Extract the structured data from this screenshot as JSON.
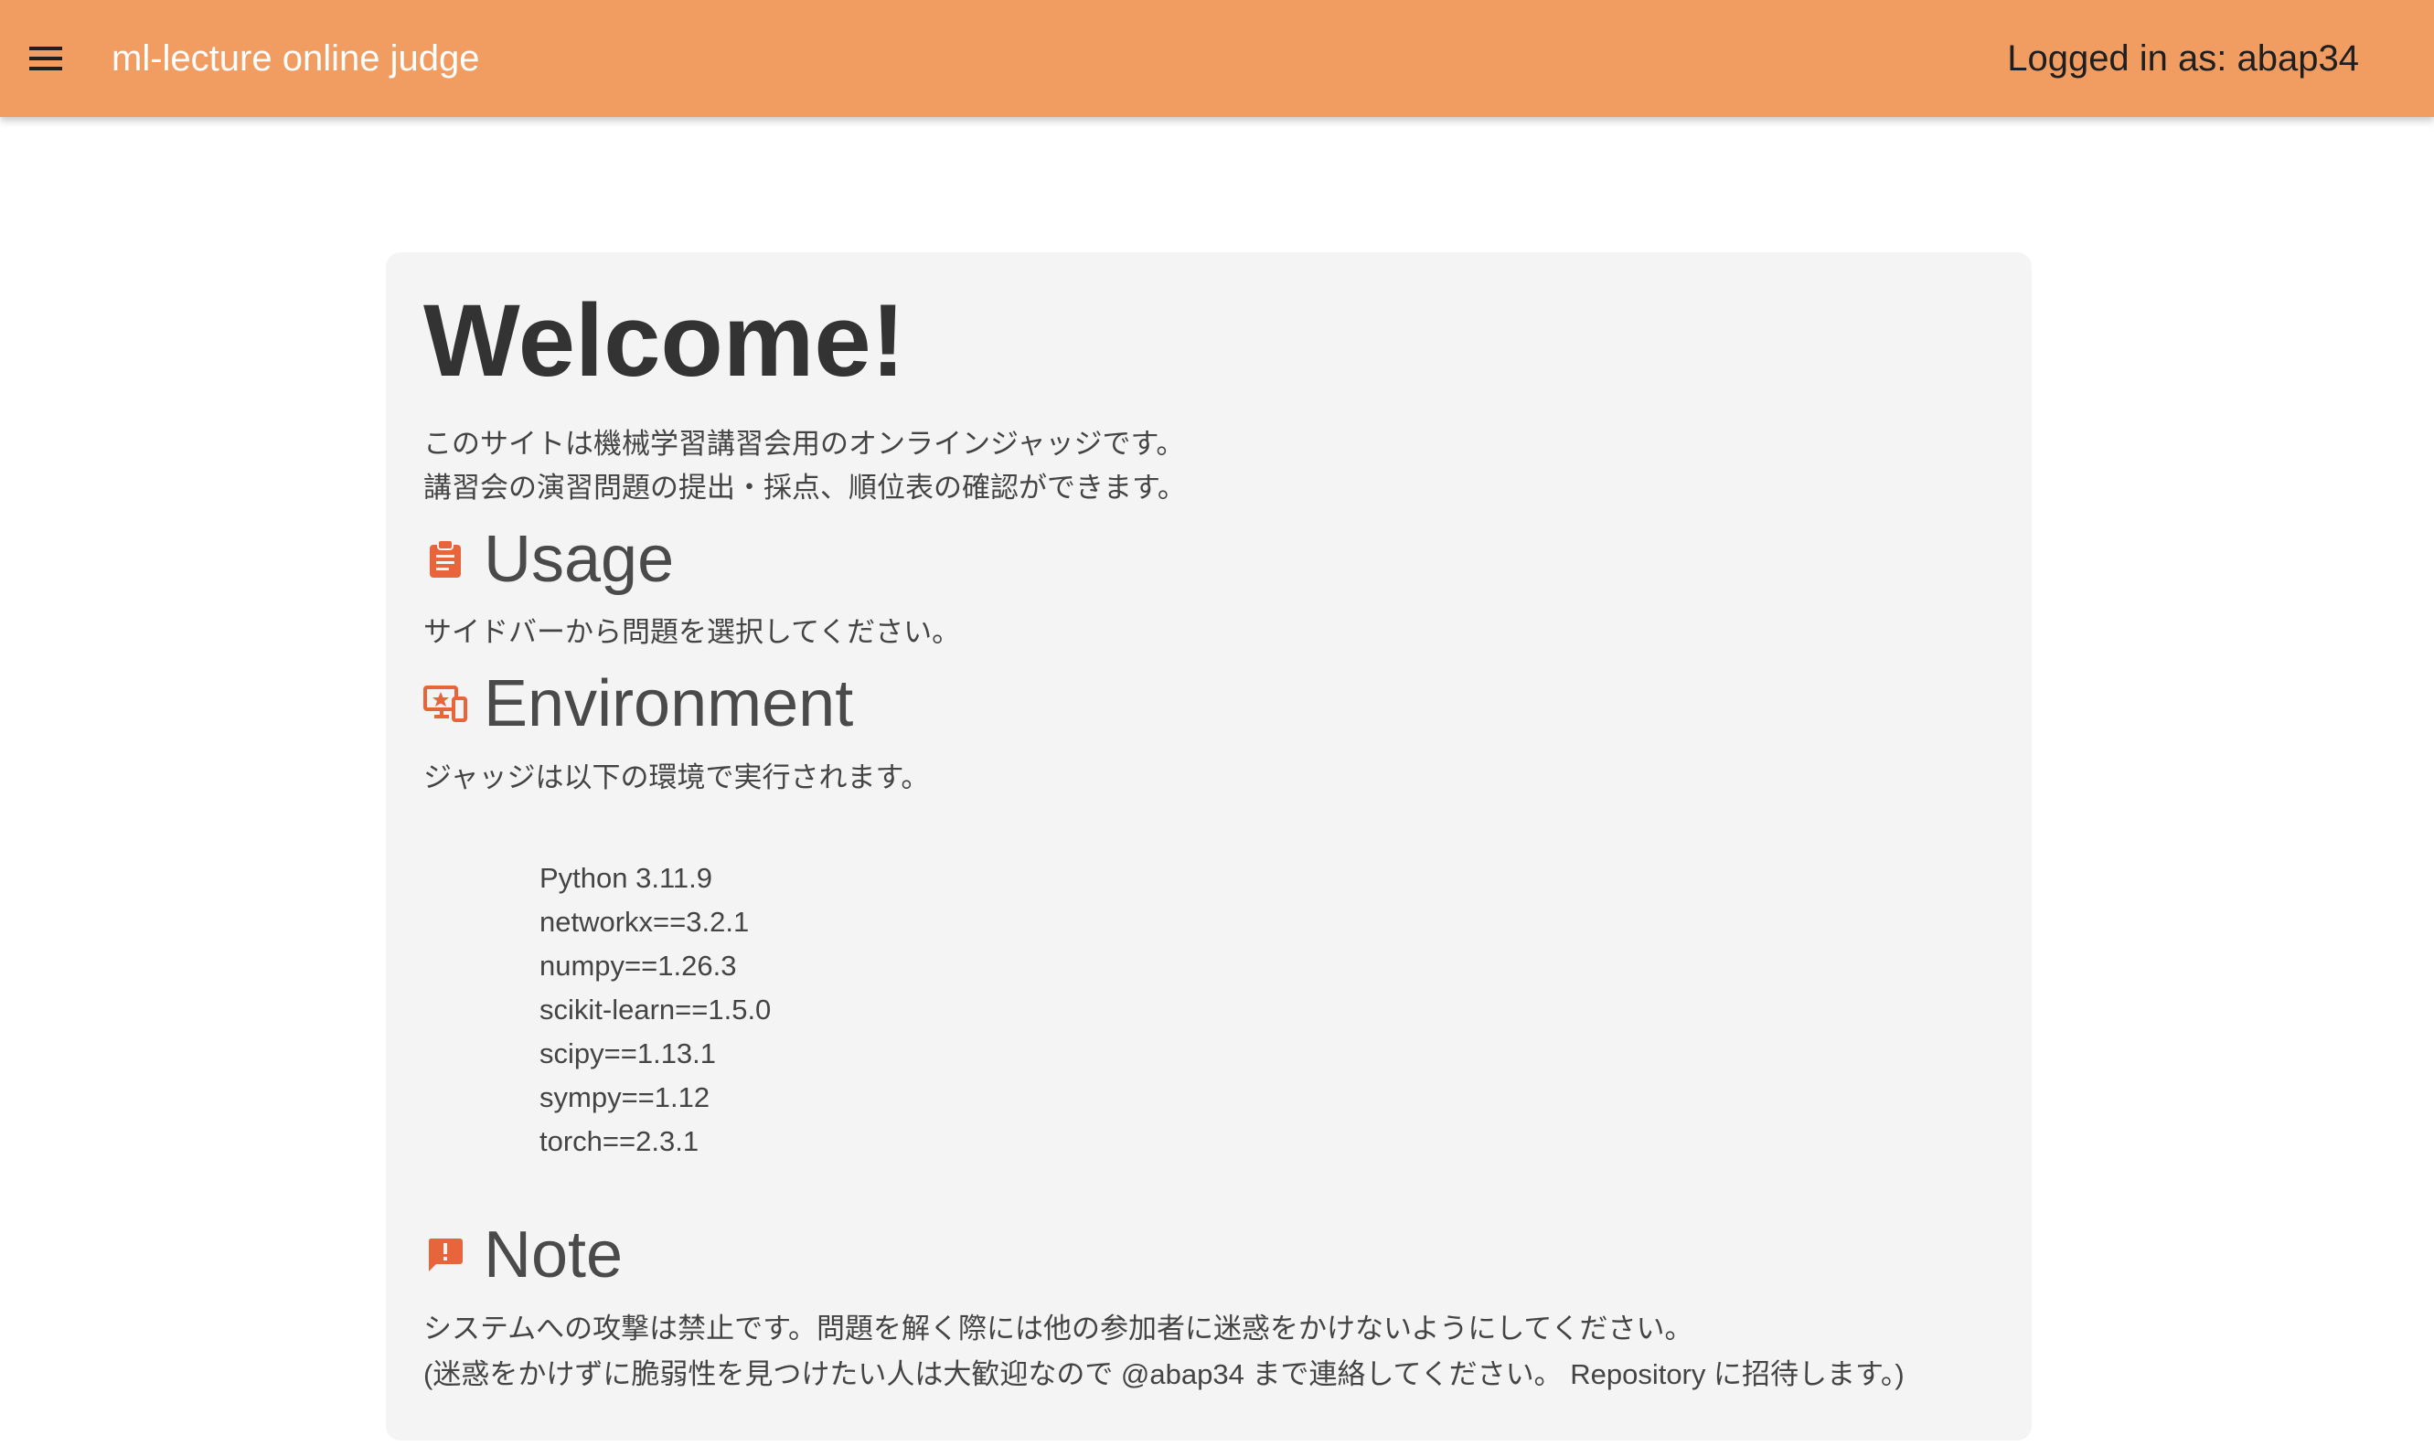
{
  "header": {
    "menu_icon": "menu-icon",
    "title": "ml-lecture online judge",
    "login_status": "Logged in as: abap34",
    "background_color": "#f19d62"
  },
  "main": {
    "welcome_title": "Welcome!",
    "intro_lines": [
      "このサイトは機械学習講習会用のオンラインジャッジです。",
      "講習会の演習問題の提出・採点、順位表の確認ができます。"
    ],
    "usage": {
      "icon": "clipboard-icon",
      "heading": "Usage",
      "text": "サイドバーから問題を選択してください。"
    },
    "environment": {
      "icon": "devices-icon",
      "heading": "Environment",
      "text": "ジャッジは以下の環境で実行されます。",
      "packages": [
        "Python 3.11.9",
        "networkx==3.2.1",
        "numpy==1.26.3",
        "scikit-learn==1.5.0",
        "scipy==1.13.1",
        "sympy==1.12",
        "torch==2.3.1"
      ]
    },
    "note": {
      "icon": "feedback-alert-icon",
      "heading": "Note",
      "lines": [
        "システムへの攻撃は禁止です。問題を解く際には他の参加者に迷惑をかけないようにしてください。",
        "(迷惑をかけずに脆弱性を見つけたい人は大歓迎なので @abap34 まで連絡してください。 Repository に招待します。)"
      ]
    },
    "accent_color": "#e8643a"
  }
}
